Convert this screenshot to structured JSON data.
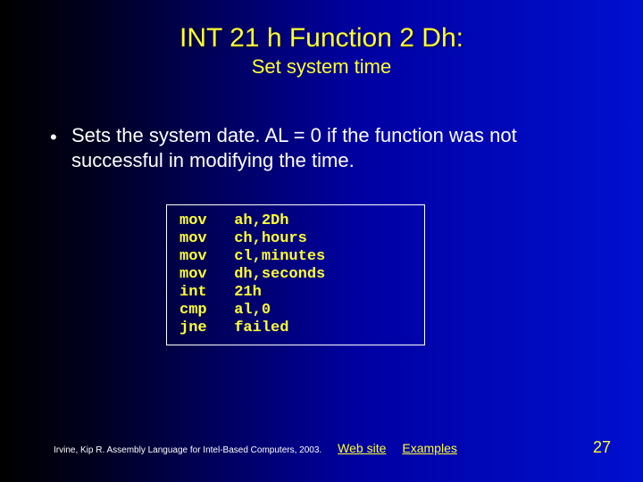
{
  "title": "INT 21 h Function 2 Dh:",
  "subtitle": "Set system time",
  "bullet_dot": "•",
  "bullet_text": "Sets the system date. AL = 0 if the function was not successful in modifying the time.",
  "code": "mov   ah,2Dh\nmov   ch,hours\nmov   cl,minutes\nmov   dh,seconds\nint   21h\ncmp   al,0\njne   failed",
  "footer": {
    "cite": "Irvine, Kip R. Assembly Language for Intel-Based Computers, 2003.",
    "links": [
      "Web site",
      "Examples"
    ],
    "page": "27"
  }
}
